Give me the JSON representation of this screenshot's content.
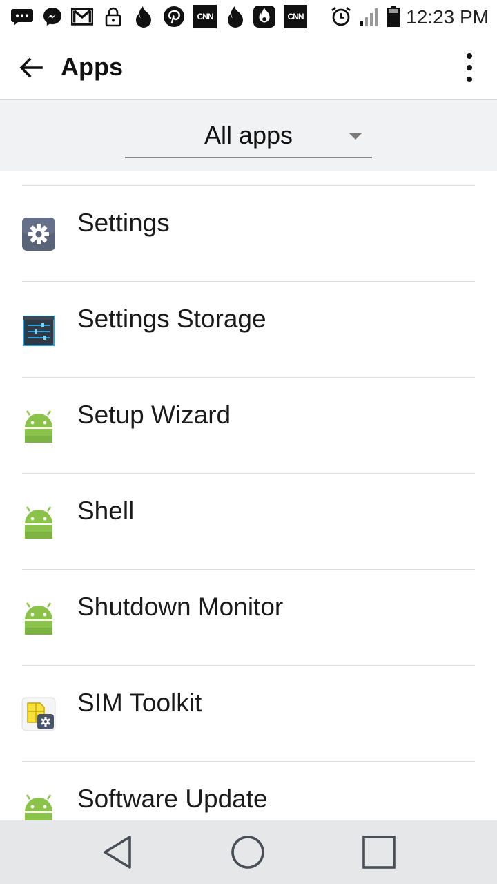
{
  "status_bar": {
    "time": "12:23 PM",
    "notification_icons": [
      "sms-icon",
      "messenger-icon",
      "gmail-icon",
      "lock-icon",
      "tinder-icon",
      "pinterest-icon",
      "cnn-icon",
      "tinder-icon",
      "hotspot-fire-icon",
      "cnn-icon"
    ],
    "cnn_label": "CNN",
    "system_icons": [
      "alarm-icon",
      "signal-icon",
      "battery-icon"
    ]
  },
  "app_bar": {
    "title": "Apps",
    "back_icon": "arrow-back-icon",
    "overflow_icon": "more-vert-icon"
  },
  "filter": {
    "selected": "All apps"
  },
  "apps": [
    {
      "name": "Settings",
      "icon": "settings-gear-icon"
    },
    {
      "name": "Settings Storage",
      "icon": "settings-storage-icon"
    },
    {
      "name": "Setup Wizard",
      "icon": "android-icon"
    },
    {
      "name": "Shell",
      "icon": "android-icon"
    },
    {
      "name": "Shutdown Monitor",
      "icon": "android-icon"
    },
    {
      "name": "SIM Toolkit",
      "icon": "sim-toolkit-icon"
    },
    {
      "name": "Software Update",
      "icon": "android-icon"
    }
  ],
  "nav_bar": {
    "buttons": [
      "back-triangle-icon",
      "home-circle-icon",
      "recents-square-icon"
    ]
  },
  "colors": {
    "android_green": "#8bc34a",
    "settings_icon_bg": "#5a6478",
    "filter_bg": "#f1f2f3",
    "nav_bg": "#e6e7e9"
  }
}
